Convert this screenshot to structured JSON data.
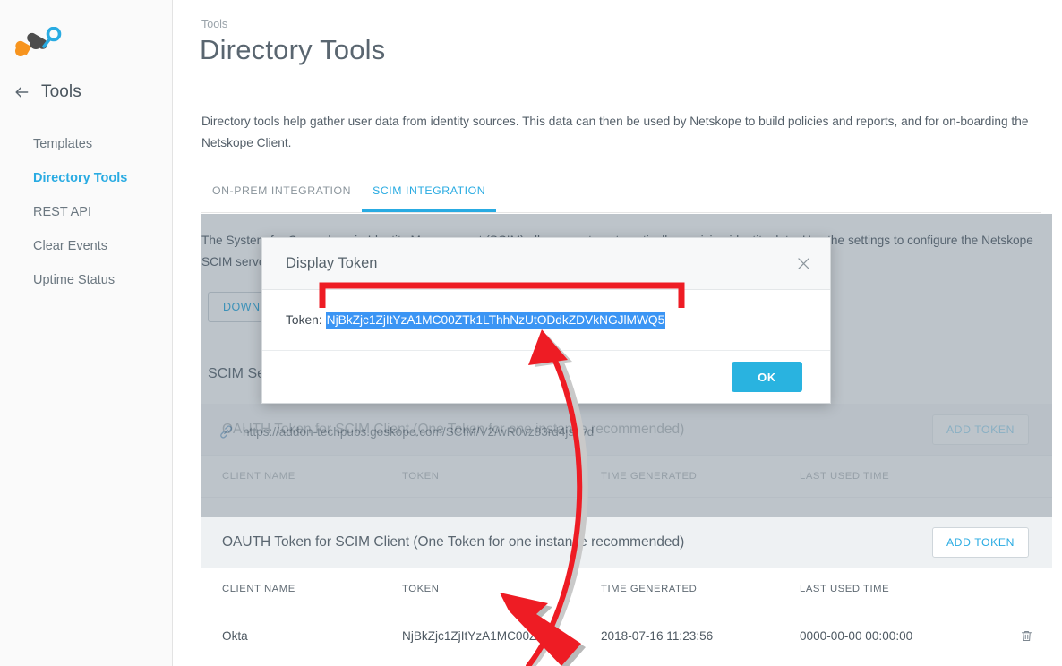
{
  "sidebar": {
    "logo_name": "netskope-logo",
    "back_label": "Tools",
    "items": [
      {
        "label": "Templates",
        "active": false
      },
      {
        "label": "Directory Tools",
        "active": true
      },
      {
        "label": "REST API",
        "active": false
      },
      {
        "label": "Clear Events",
        "active": false
      },
      {
        "label": "Uptime Status",
        "active": false
      }
    ]
  },
  "header": {
    "breadcrumb": "Tools",
    "title": "Directory Tools",
    "description": "Directory tools help gather user data from identity sources. This data can then be used by Netskope to build policies and reports, and for on-boarding the Netskope Client."
  },
  "tabs": [
    {
      "label": "ON-PREM INTEGRATION",
      "active": false
    },
    {
      "label": "SCIM INTEGRATION",
      "active": true
    }
  ],
  "content": {
    "intro_text": "The System for Cross-domain Identity Management (SCIM) allows you to automatically provision identity data. Use the settings to configure the Netskope SCIM server to receive identity data.",
    "download_button": "DOWNLOAD",
    "scim_section_title": "SCIM Server URL",
    "url_icon": "link-icon",
    "url": "https://addon-techpubs.goskope.com/SCIM/V2/wR0vz83rd4js6vd",
    "oauth_band": {
      "title": "OAUTH Token for SCIM Client (One Token for one instance recommended)",
      "add_button": "ADD TOKEN"
    },
    "table": {
      "columns": [
        "CLIENT NAME",
        "TOKEN",
        "TIME GENERATED",
        "LAST USED TIME"
      ],
      "rows": [
        {
          "client_name": "Okta",
          "token": "NjBkZjc1ZjItYzA1MC00ZTk...",
          "time_generated": "2018-07-16 11:23:56",
          "last_used_time": "0000-00-00 00:00:00",
          "delete_icon": "trash-icon"
        }
      ]
    }
  },
  "modal": {
    "title": "Display Token",
    "close_icon": "close-icon",
    "token_label": "Token:",
    "token_value": "NjBkZjc1ZjItYzA1MC00ZTk1LThhNzUtODdkZDVkNGJlMWQ5",
    "ok_button": "OK"
  },
  "annotations": {
    "bracket_color": "#ee1c24",
    "arrow_color": "#ee1c24",
    "shadow_arrow_color": "#b5b5b5"
  },
  "colors": {
    "accent": "#29abe2",
    "ok_button": "#29b3e0",
    "selection_blue": "#3b95f4",
    "scrim": "#5a6c7a",
    "text": "#55606a",
    "logo_orange": "#f7941e",
    "logo_dark": "#4d4d4d",
    "logo_blue": "#29abe2"
  }
}
